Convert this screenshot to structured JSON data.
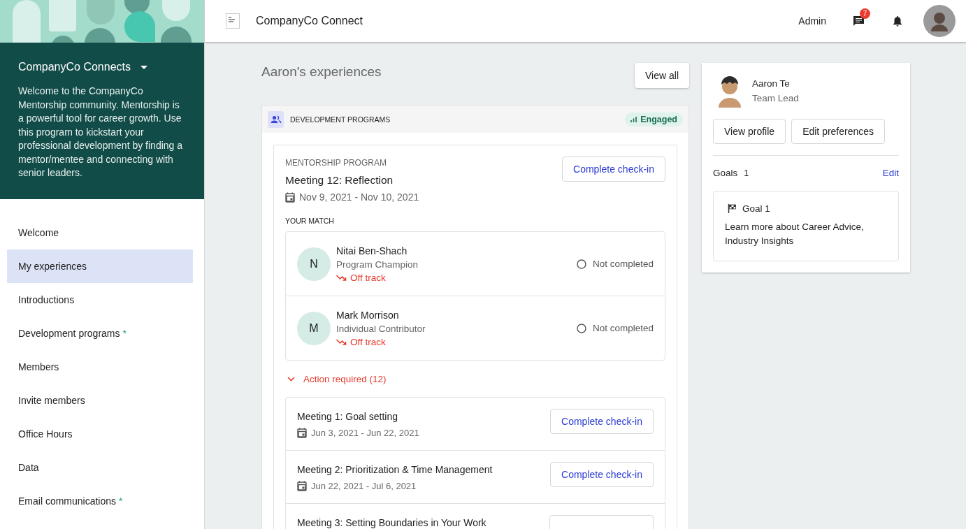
{
  "sidebar": {
    "community": "CompanyCo Connects",
    "description": "Welcome to the CompanyCo Mentorship community. Mentorship is a powerful tool for career growth. Use this program to kickstart your professional development by finding a mentor/mentee and connecting with senior leaders.",
    "items": [
      {
        "label": "Welcome",
        "selected": false
      },
      {
        "label": "My experiences",
        "selected": true
      },
      {
        "label": "Introductions",
        "selected": false
      },
      {
        "label": "Development programs",
        "marker": "*",
        "selected": false
      },
      {
        "label": "Members",
        "selected": false
      },
      {
        "label": "Invite members",
        "selected": false
      },
      {
        "label": "Office Hours",
        "selected": false
      },
      {
        "label": "Data",
        "selected": false
      },
      {
        "label": "Email communications",
        "marker": "*",
        "selected": false
      }
    ]
  },
  "header": {
    "title": "CompanyCo Connect",
    "admin": "Admin",
    "messages_badge": "7"
  },
  "experiences": {
    "title": "Aaron's experiences",
    "view_all": "View all",
    "section": "DEVELOPMENT PROGRAMS",
    "status": "Engaged",
    "program": {
      "category": "MENTORSHIP PROGRAM",
      "meeting": "Meeting 12: Reflection",
      "dates": "Nov 9, 2021 - Nov 10, 2021",
      "action": "Complete check-in",
      "match_label": "YOUR MATCH",
      "matches": [
        {
          "initial": "N",
          "name": "Nitai Ben-Shach",
          "role": "Program Champion",
          "track": "Off track",
          "status": "Not completed",
          "completed": false
        },
        {
          "initial": "M",
          "name": "Mark Morrison",
          "role": "Individual Contributor",
          "track": "Off track",
          "status": "Not completed",
          "completed": false
        }
      ],
      "action_required": {
        "label": "Action required (12)",
        "expanded": true,
        "meetings": [
          {
            "title": "Meeting 1: Goal setting",
            "dates": "Jun 3, 2021 - Jun 22, 2021",
            "action": "Complete check-in"
          },
          {
            "title": "Meeting 2: Prioritization & Time Management",
            "dates": "Jun 22, 2021 - Jul 6, 2021",
            "action": "Complete check-in"
          },
          {
            "title": "Meeting 3: Setting Boundaries in Your Work"
          }
        ]
      }
    }
  },
  "profile": {
    "name": "Aaron Te",
    "role": "Team Lead",
    "buttons": [
      "View profile",
      "Edit preferences"
    ],
    "goals_label": "Goals",
    "goals_count": "1",
    "edit": "Edit",
    "goals": [
      {
        "title": "Goal 1",
        "text": "Learn more about Career Advice, Industry Insights"
      }
    ]
  }
}
